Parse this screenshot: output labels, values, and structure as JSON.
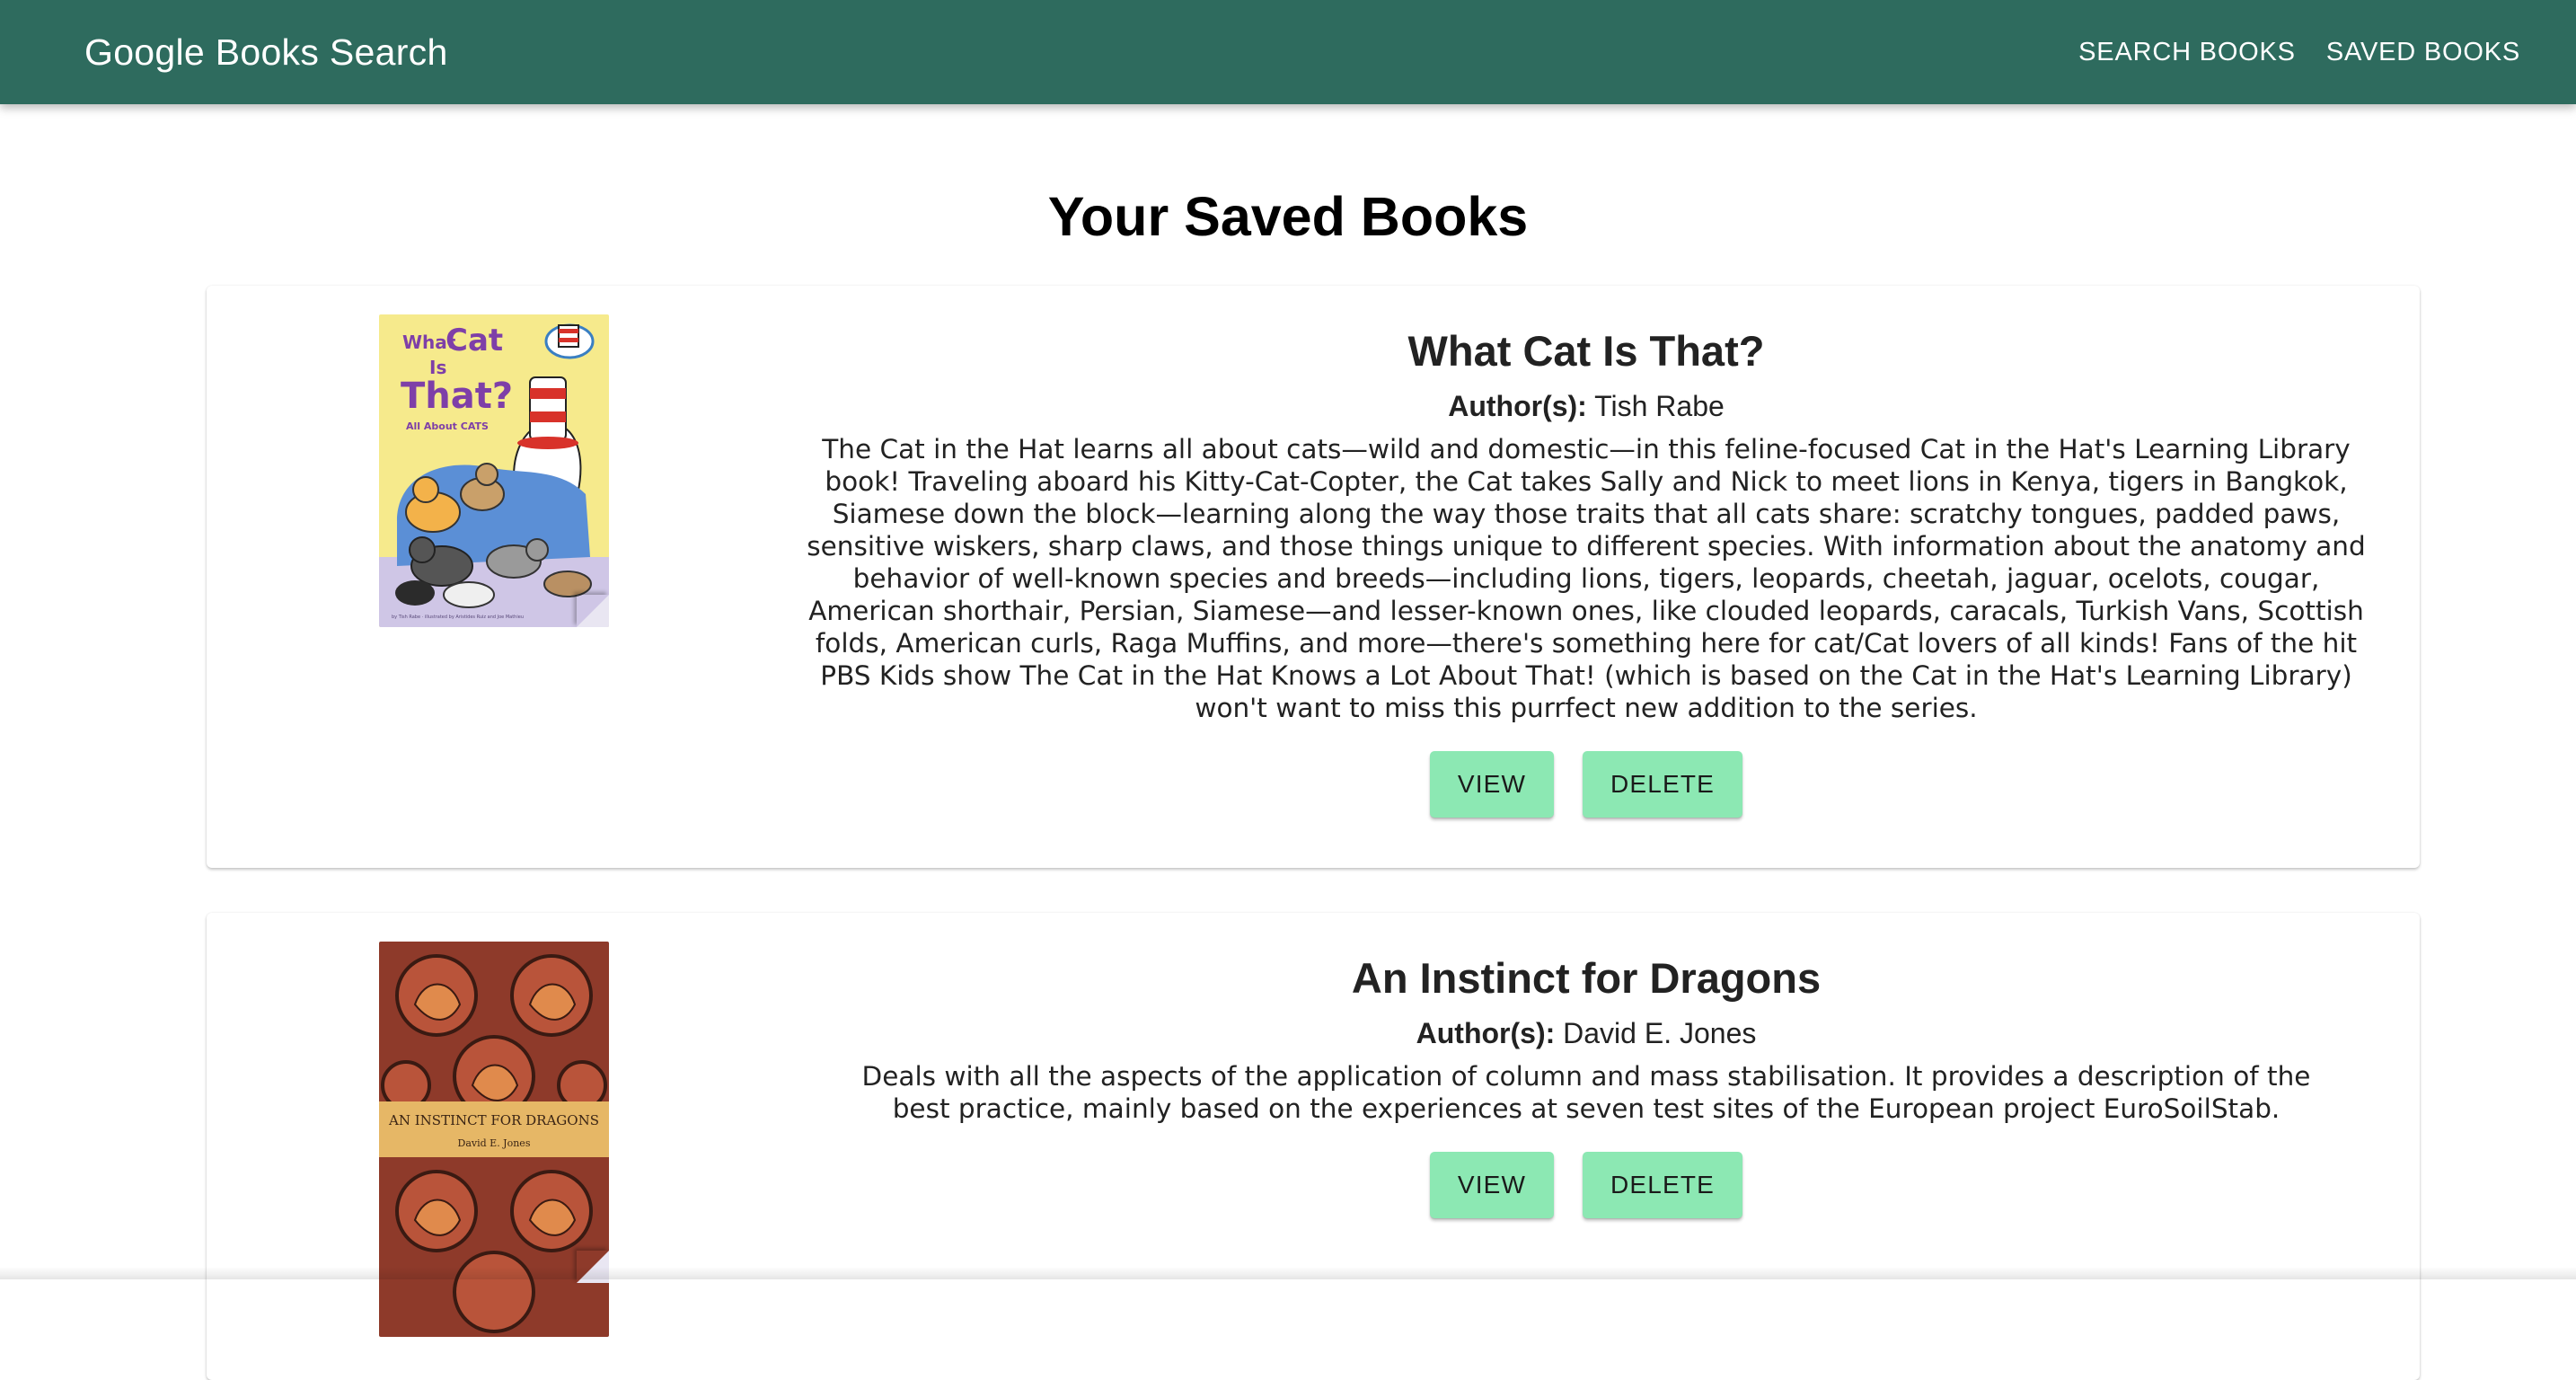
{
  "header": {
    "brand": "Google Books Search",
    "nav": {
      "search_label": "SEARCH BOOKS",
      "saved_label": "SAVED BOOKS"
    }
  },
  "page": {
    "title": "Your Saved Books"
  },
  "books": [
    {
      "title": "What Cat Is That?",
      "author_label": "Author(s):",
      "authors": "Tish Rabe",
      "description": "The Cat in the Hat learns all about cats—wild and domestic—in this feline-focused Cat in the Hat's Learning Library book! Traveling aboard his Kitty-Cat-Copter, the Cat takes Sally and Nick to meet lions in Kenya, tigers in Bangkok, Siamese down the block—learning along the way those traits that all cats share: scratchy tongues, padded paws, sensitive wiskers, sharp claws, and those things unique to different species. With information about the anatomy and behavior of well-known species and breeds—including lions, tigers, leopards, cheetah, jaguar, ocelots, cougar, American shorthair, Persian, Siamese—and lesser-known ones, like clouded leopards, caracals, Turkish Vans, Scottish folds, American curls, Raga Muffins, and more—there's something here for cat/Cat lovers of all kinds! Fans of the hit PBS Kids show The Cat in the Hat Knows a Lot About That! (which is based on the Cat in the Hat's Learning Library) won't want to miss this purrfect new addition to the series.",
      "view_label": "VIEW",
      "delete_label": "DELETE",
      "cover": {
        "title_line1": "What",
        "title_line2": "Cat",
        "title_line3": "Is",
        "title_line4": "That?",
        "subtitle": "All About CATS",
        "credit": "by Tish Rabe · illustrated by Aristides Ruiz and Joe Mathieu"
      }
    },
    {
      "title": "An Instinct for Dragons",
      "author_label": "Author(s):",
      "authors": "David E. Jones",
      "description": "Deals with all the aspects of the application of column and mass stabilisation. It provides a description of the best practice, mainly based on the experiences at seven test sites of the European project EuroSoilStab.",
      "view_label": "VIEW",
      "delete_label": "DELETE",
      "cover": {
        "title": "AN INSTINCT FOR DRAGONS",
        "author": "David E. Jones"
      }
    }
  ],
  "colors": {
    "appbar": "#2e6b5e",
    "button": "#8ce8b3"
  }
}
